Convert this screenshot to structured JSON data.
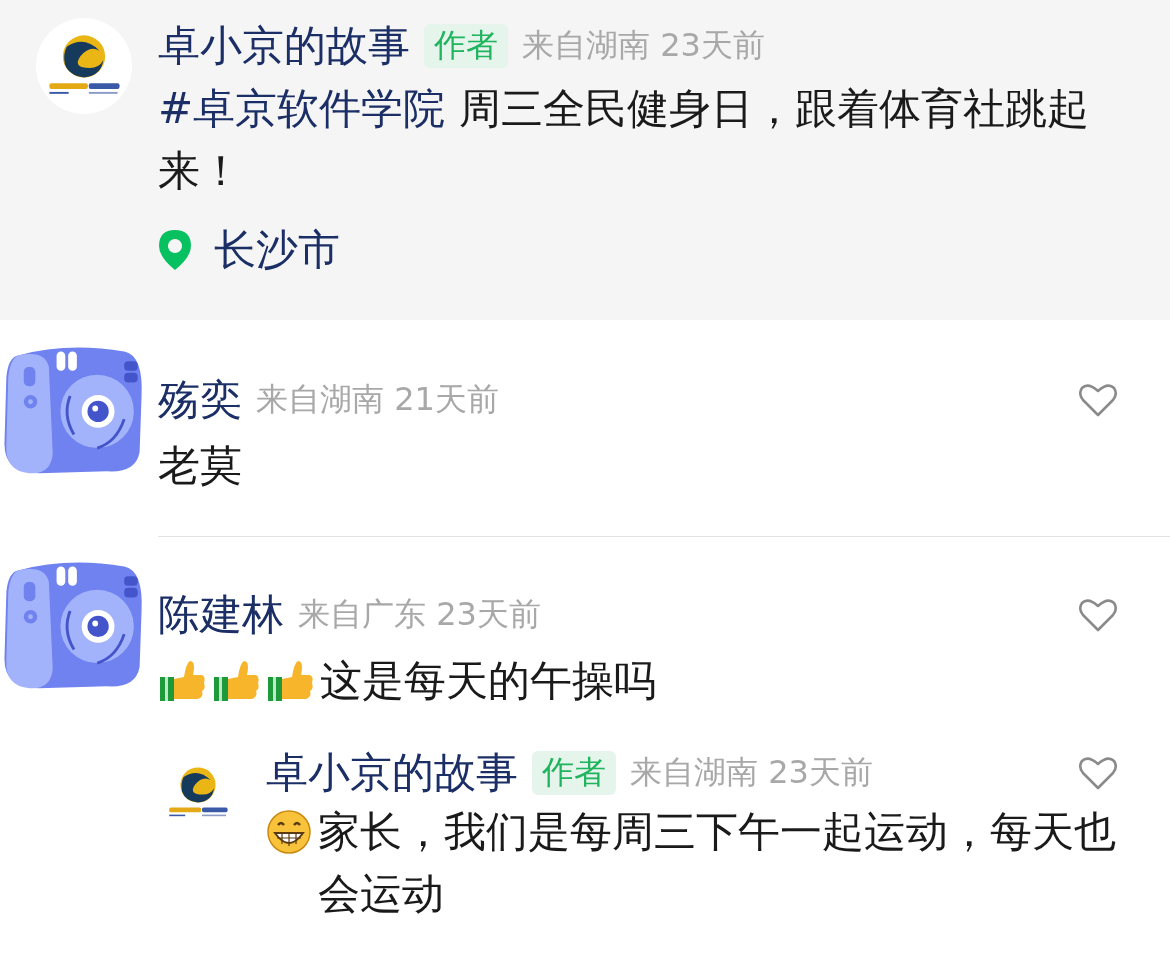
{
  "post": {
    "author": "卓小京的故事",
    "badge": "作者",
    "meta": "来自湖南 23天前",
    "topic": "#卓京软件学院",
    "text": " 周三全民健身日，跟着体育社跳起来！",
    "location": "长沙市"
  },
  "comments": [
    {
      "name": "殇奕",
      "meta": "来自湖南 21天前",
      "text": "老莫",
      "liked": false
    },
    {
      "name": "陈建林",
      "meta": "来自广东 23天前",
      "emojis": [
        {
          "kind": "thumbs-up"
        },
        {
          "kind": "thumbs-up"
        },
        {
          "kind": "thumbs-up"
        }
      ],
      "text": "这是每天的午操吗",
      "liked": false,
      "replies": [
        {
          "name": "卓小京的故事",
          "badge": "作者",
          "meta": "来自湖南 23天前",
          "emojis": [
            {
              "kind": "grin"
            }
          ],
          "text": "家长，我们是每周三下午一起运动，每天也会运动",
          "liked": false
        }
      ]
    }
  ]
}
